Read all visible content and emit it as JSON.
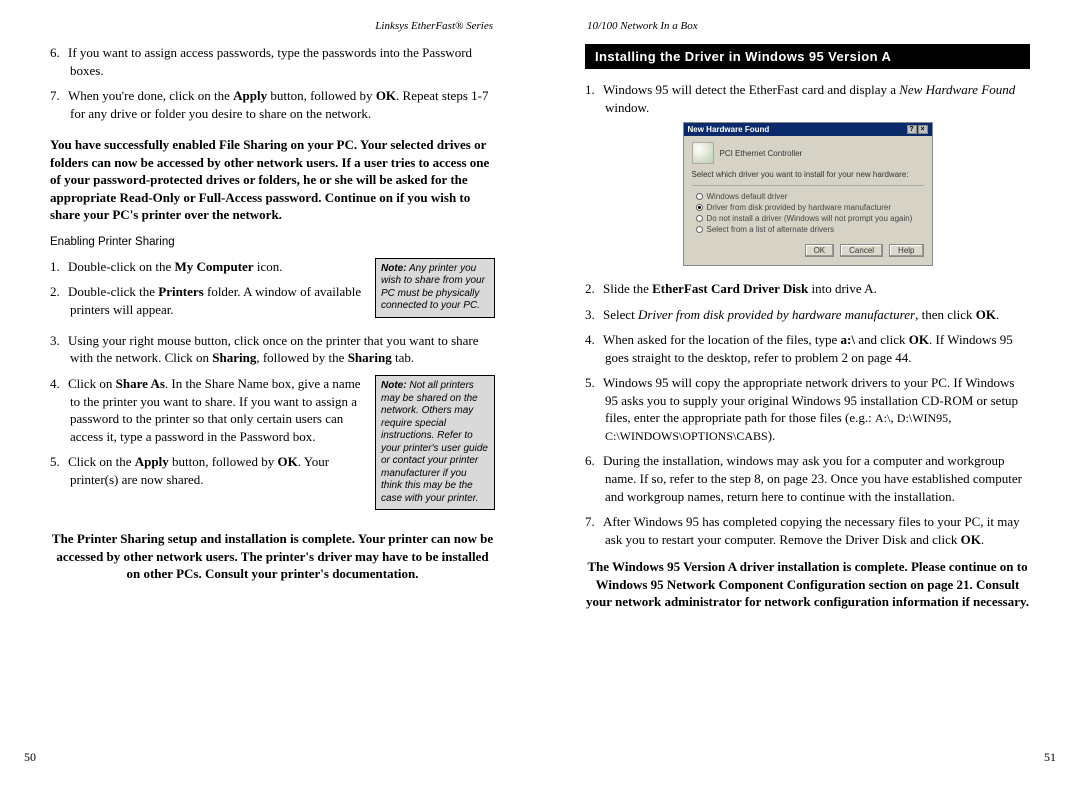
{
  "left": {
    "header": "Linksys EtherFast® Series",
    "page_num": "50",
    "step6": "If you want to assign access passwords, type the passwords into the Password boxes.",
    "step7_pre": "When you're done, click on the ",
    "step7_apply": "Apply",
    "step7_mid": " button, followed by ",
    "step7_ok": "OK",
    "step7_post": ". Repeat steps 1-7 for any drive or folder you desire to share on the network.",
    "bold1": "You have successfully enabled File Sharing on your PC. Your selected drives or folders can now be accessed by other network users. If a user tries to access one of your password-protected drives or folders, he or she will be asked for the appropriate Read-Only or Full-Access password. Continue on if you wish to share your PC's printer over the network.",
    "sub1": "Enabling Printer Sharing",
    "note1_label": "Note:",
    "note1_text": " Any printer you wish to share from your PC must be physically connected to your PC.",
    "p1_pre": "Double-click on the ",
    "p1_b": "My Computer",
    "p1_post": " icon.",
    "p2_pre": "Double-click the ",
    "p2_b": "Printers",
    "p2_post": " folder. A window of available printers will appear.",
    "p3_pre": "Using your right mouse button, click once on the printer that you want to share with the network. Click on ",
    "p3_b1": "Sharing",
    "p3_mid": ", followed by the ",
    "p3_b2": "Sharing",
    "p3_post": " tab.",
    "note2_label": "Note:",
    "note2_text": " Not all printers may be shared on the network. Others may require special instructions. Refer to your printer's user guide or contact your printer manufacturer if you think this may be the case with your printer.",
    "p4_pre": "Click on ",
    "p4_b": "Share As",
    "p4_post": ". In the Share Name box, give a name to the printer you want to share. If you want to assign a password to the printer so that only certain users can access it, type a password in the Password box.",
    "p5_pre": "Click on the ",
    "p5_b1": "Apply",
    "p5_mid": " button, followed by ",
    "p5_b2": "OK",
    "p5_post": ". Your printer(s) are now shared.",
    "bold2": "The Printer Sharing setup and installation is complete.  Your printer can now be accessed by other network users. The printer's driver may have to be installed on other PCs. Consult your printer's documentation."
  },
  "right": {
    "header": "10/100 Network In a Box",
    "page_num": "51",
    "section_title": "Installing the Driver in Windows 95 Version A",
    "r1_pre": "Windows 95 will detect the EtherFast card and display a ",
    "r1_i": "New Hardware Found",
    "r1_post": " window.",
    "ss_title": "New Hardware Found",
    "ss_hw": "PCI Ethernet Controller",
    "ss_prompt": "Select which driver you want to install for your new hardware:",
    "ss_opt1": "Windows default driver",
    "ss_opt2": "Driver from disk provided by hardware manufacturer",
    "ss_opt3": "Do not install a driver (Windows will not prompt you again)",
    "ss_opt4": "Select from a list of alternate drivers",
    "ss_ok": "OK",
    "ss_cancel": "Cancel",
    "ss_help": "Help",
    "r2_pre": "Slide the ",
    "r2_b": "EtherFast Card Driver Disk",
    "r2_post": " into drive A.",
    "r3_pre": "Select ",
    "r3_i": "Driver from disk provided by hardware manufacturer",
    "r3_mid": ", then click ",
    "r3_b": "OK",
    "r3_post": ".",
    "r4_pre": "When asked for the location of the files, type ",
    "r4_b1": "a:\\",
    "r4_mid": " and click ",
    "r4_b2": "OK",
    "r4_post": ". If Windows 95 goes straight to the desktop, refer to problem 2 on page 44.",
    "r5_pre": "Windows 95 will copy the appropriate network drivers to your PC. If Windows 95 asks you to supply your original Windows 95 installation CD-ROM or setup files, enter the appropriate path for those files (e.g.: ",
    "r5_sc1": "A:\\",
    "r5_mid1": ", ",
    "r5_sc2": "D:\\WIN95",
    "r5_mid2": ", ",
    "r5_sc3": "C:\\WINDOWS\\OPTIONS\\CABS",
    "r5_post": ").",
    "r6": "During the installation, windows may ask you for a computer and workgroup name. If so, refer to the step 8, on page 23. Once you have established computer and workgroup names, return here to continue with the installation.",
    "r7_pre": "After Windows 95 has completed copying the necessary files to your PC, it may ask you to restart your computer. Remove the Driver Disk and click ",
    "r7_b": "OK",
    "r7_post": ".",
    "final": "The Windows 95 Version A driver installation is complete. Please continue on to Windows 95 Network Component Configuration section on page 21. Consult your network administrator for network configuration information if necessary."
  }
}
